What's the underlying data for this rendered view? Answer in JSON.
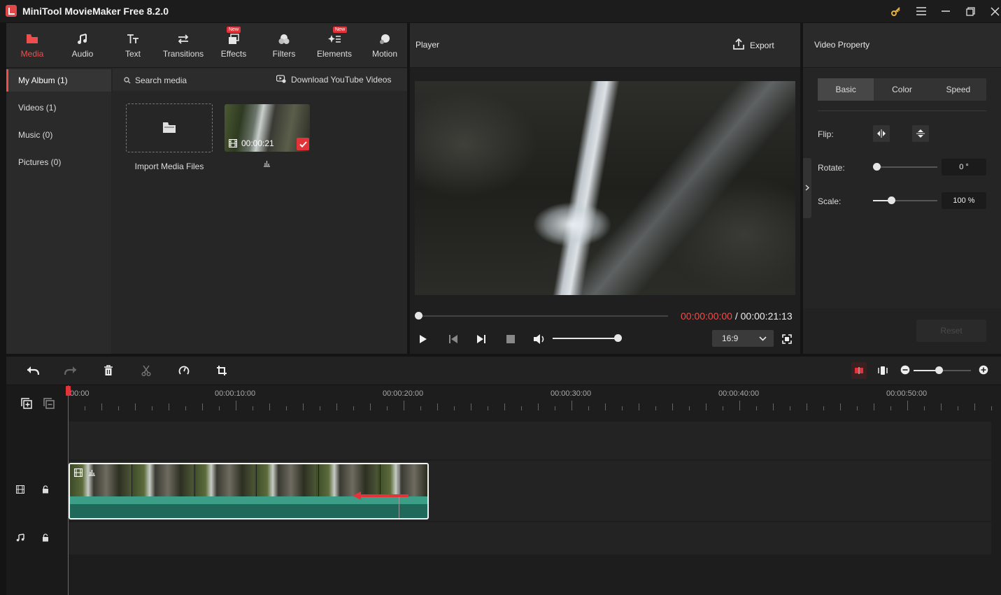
{
  "window": {
    "title": "MiniTool MovieMaker Free 8.2.0",
    "controls": [
      "key-icon",
      "menu-icon",
      "minimize-icon",
      "restore-icon",
      "close-icon"
    ]
  },
  "toolbar_tabs": [
    {
      "label": "Media",
      "icon": "media-icon",
      "active": true,
      "badge": ""
    },
    {
      "label": "Audio",
      "icon": "music-note-icon",
      "active": false,
      "badge": ""
    },
    {
      "label": "Text",
      "icon": "text-icon",
      "active": false,
      "badge": ""
    },
    {
      "label": "Transitions",
      "icon": "transitions-icon",
      "active": false,
      "badge": ""
    },
    {
      "label": "Effects",
      "icon": "effects-icon",
      "active": false,
      "badge": "New"
    },
    {
      "label": "Filters",
      "icon": "filters-icon",
      "active": false,
      "badge": ""
    },
    {
      "label": "Elements",
      "icon": "elements-icon",
      "active": false,
      "badge": "New"
    },
    {
      "label": "Motion",
      "icon": "motion-icon",
      "active": false,
      "badge": ""
    }
  ],
  "album": {
    "items": [
      {
        "label": "My Album (1)",
        "active": true
      },
      {
        "label": "Videos (1)",
        "active": false
      },
      {
        "label": "Music (0)",
        "active": false
      },
      {
        "label": "Pictures (0)",
        "active": false
      }
    ]
  },
  "media": {
    "search_placeholder": "Search media",
    "download_label": "Download YouTube Videos",
    "import_label": "Import Media Files",
    "clip_duration": "00:00:21"
  },
  "player": {
    "title": "Player",
    "export_label": "Export",
    "current_time": "00:00:00:00",
    "separator": " / ",
    "total_time": "00:00:21:13",
    "aspect_ratio": "16:9",
    "progress": 0,
    "volume": 1
  },
  "property": {
    "title": "Video Property",
    "tabs": [
      {
        "label": "Basic",
        "active": true
      },
      {
        "label": "Color",
        "active": false
      },
      {
        "label": "Speed",
        "active": false
      }
    ],
    "flip_label": "Flip:",
    "rotate_label": "Rotate:",
    "rotate_value": "0 °",
    "scale_label": "Scale:",
    "scale_value": "100 %",
    "reset_label": "Reset"
  },
  "timeline": {
    "ruler_labels": [
      "00:00",
      "00:00:10:00",
      "00:00:20:00",
      "00:00:30:00",
      "00:00:40:00",
      "00:00:50:00"
    ]
  },
  "colors": {
    "accent": "#f04d4d",
    "clip_green": "#20685a",
    "panel_bg": "#252525"
  }
}
